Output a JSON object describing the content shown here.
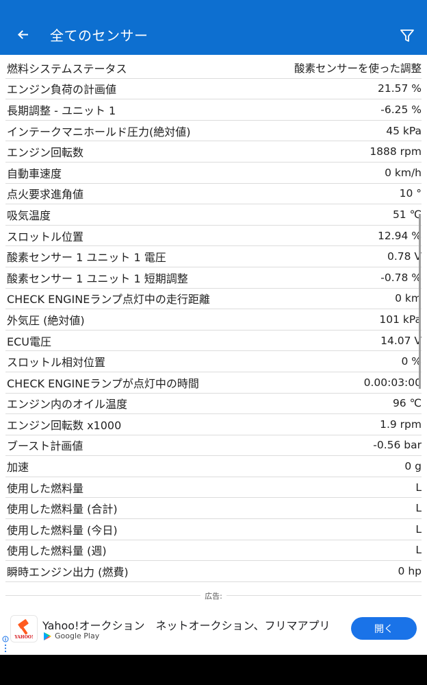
{
  "appbar": {
    "title": "全てのセンサー",
    "back_icon": "arrow-left-icon",
    "filter_icon": "filter-icon",
    "background": "#0d6fd0"
  },
  "sensors": [
    {
      "label": "燃料システムステータス",
      "value": "酸素センサーを使った調整"
    },
    {
      "label": "エンジン負荷の計画値",
      "value": "21.57 %"
    },
    {
      "label": "長期調整 - ユニット 1",
      "value": "-6.25 %"
    },
    {
      "label": "インテークマニホールド圧力(絶対値)",
      "value": "45 kPa"
    },
    {
      "label": "エンジン回転数",
      "value": "1888 rpm"
    },
    {
      "label": "自動車速度",
      "value": "0 km/h"
    },
    {
      "label": "点火要求進角値",
      "value": "10 °"
    },
    {
      "label": "吸気温度",
      "value": "51 ℃"
    },
    {
      "label": "スロットル位置",
      "value": "12.94 %"
    },
    {
      "label": "酸素センサー 1 ユニット 1 電圧",
      "value": "0.78 V"
    },
    {
      "label": "酸素センサー 1 ユニット 1 短期調整",
      "value": "-0.78 %"
    },
    {
      "label": "CHECK ENGINEランプ点灯中の走行距離",
      "value": "0 km"
    },
    {
      "label": "外気圧 (絶対値)",
      "value": "101 kPa"
    },
    {
      "label": "ECU電圧",
      "value": "14.07 V"
    },
    {
      "label": "スロットル相対位置",
      "value": "0 %"
    },
    {
      "label": "CHECK ENGINEランプが点灯中の時間",
      "value": "0.00:03:00"
    },
    {
      "label": "エンジン内のオイル温度",
      "value": "96 ℃"
    },
    {
      "label": "エンジン回転数 x1000",
      "value": "1.9 rpm"
    },
    {
      "label": "ブースト計画値",
      "value": "-0.56 bar"
    },
    {
      "label": "加速",
      "value": "0 g"
    },
    {
      "label": "使用した燃料量",
      "value": "L"
    },
    {
      "label": "使用した燃料量 (合計)",
      "value": "L"
    },
    {
      "label": "使用した燃料量 (今日)",
      "value": "L"
    },
    {
      "label": "使用した燃料量 (週)",
      "value": "L"
    },
    {
      "label": "瞬時エンジン出力 (燃費)",
      "value": "0 hp"
    }
  ],
  "ad": {
    "label": "広告:",
    "headline": "Yahoo!オークション　ネットオークション、フリマアプリ",
    "store": "Google Play",
    "open_label": "開く",
    "icon_brand": "YAHOO!",
    "button_color": "#1a73e8"
  }
}
